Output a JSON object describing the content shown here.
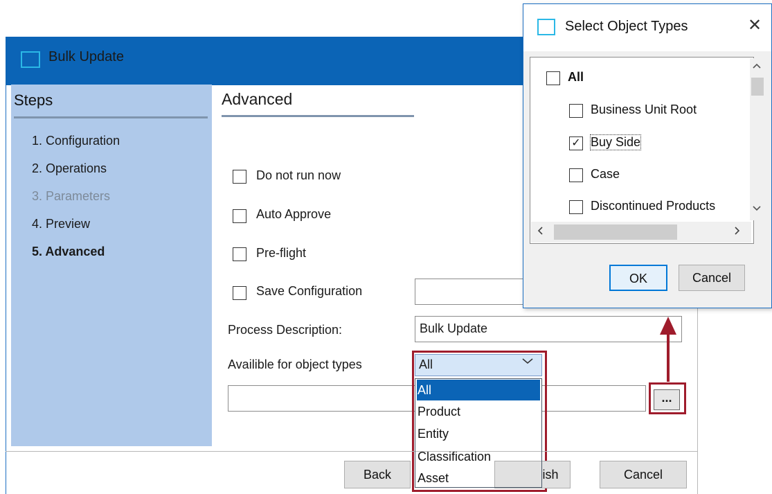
{
  "main_window": {
    "title": "Bulk Update",
    "steps_heading": "Steps",
    "steps": [
      {
        "label": "1. Configuration"
      },
      {
        "label": "2. Operations"
      },
      {
        "label": "3. Parameters"
      },
      {
        "label": "4. Preview"
      },
      {
        "label": "5. Advanced"
      }
    ],
    "section_title": "Advanced",
    "options": {
      "do_not_run_now": "Do not run now",
      "auto_approve": "Auto Approve",
      "pre_flight": "Pre-flight",
      "save_configuration": "Save Configuration"
    },
    "process_description_label": "Process Description:",
    "process_description_value": "Bulk Update",
    "object_types_label": "Availible for object types",
    "object_types_selected": "All",
    "object_types_options": [
      "All",
      "Product",
      "Entity",
      "Classification",
      "Asset"
    ],
    "browse_label": "...",
    "buttons": {
      "back": "Back",
      "finish": "ish",
      "cancel": "Cancel"
    }
  },
  "dialog": {
    "title": "Select Object Types",
    "close_glyph": "✕",
    "items": [
      {
        "label": "All",
        "checked": false
      },
      {
        "label": "Business Unit Root",
        "checked": false
      },
      {
        "label": "Buy Side",
        "checked": true
      },
      {
        "label": "Case",
        "checked": false
      },
      {
        "label": "Discontinued Products",
        "checked": false
      }
    ],
    "check_glyph": "✓",
    "buttons": {
      "ok": "OK",
      "cancel": "Cancel"
    }
  },
  "colors": {
    "titlebar": "#0b64b6",
    "steps_panel": "#afc9ea",
    "highlight": "#9f1c2c",
    "selection": "#0b64b6"
  },
  "icons": [
    "window-icon",
    "close-icon",
    "chevron-down-icon",
    "scroll-up-icon",
    "scroll-down-icon",
    "scroll-left-icon",
    "scroll-right-icon",
    "arrow-up-icon"
  ]
}
